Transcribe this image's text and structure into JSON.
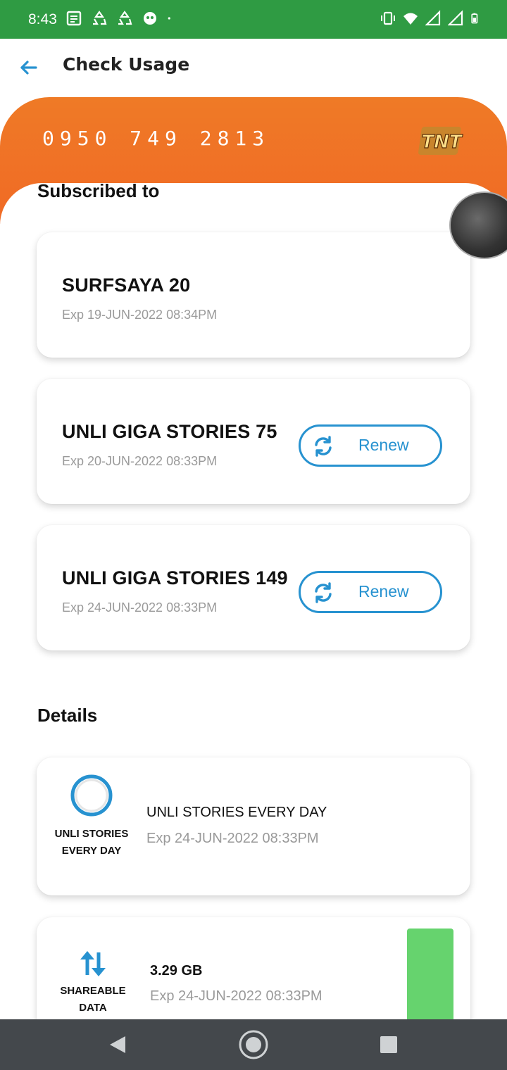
{
  "status_bar": {
    "time": "8:43",
    "left_icons": [
      "news-icon",
      "recycle-icon",
      "recycle-icon",
      "game-icon",
      "dot-icon"
    ],
    "right_icons": [
      "vibrate-icon",
      "wifi-icon",
      "signal-icon",
      "signal-icon",
      "battery-icon"
    ]
  },
  "header": {
    "title": "Check Usage"
  },
  "sim": {
    "number": "0950 749 2813",
    "brand_logo": "TNT"
  },
  "subscribed": {
    "title": "Subscribed to",
    "plans": [
      {
        "name": "SURFSAYA 20",
        "exp": "Exp 19-JUN-2022 08:34PM",
        "renew": null
      },
      {
        "name": "UNLI GIGA STORIES 75",
        "exp": "Exp 20-JUN-2022 08:33PM",
        "renew": "Renew"
      },
      {
        "name": "UNLI GIGA STORIES 149",
        "exp": "Exp 24-JUN-2022 08:33PM",
        "renew": "Renew"
      }
    ]
  },
  "details": {
    "title": "Details",
    "items": [
      {
        "badge_label": "UNLI STORIES EVERY DAY",
        "name": "UNLI STORIES EVERY DAY",
        "exp": "Exp 24-JUN-2022 08:33PM",
        "icon": "ring-icon"
      },
      {
        "badge_label": "SHAREABLE DATA",
        "name": "3.29 GB",
        "exp": "Exp 24-JUN-2022 08:33PM",
        "icon": "up-down-arrows-icon",
        "usage_level": 1.0,
        "bar_color": "#66d36e"
      }
    ]
  },
  "colors": {
    "status_bar": "#2f9b43",
    "banner": "#f07225",
    "accent": "#2792d0",
    "nav_bar": "#44484c"
  }
}
